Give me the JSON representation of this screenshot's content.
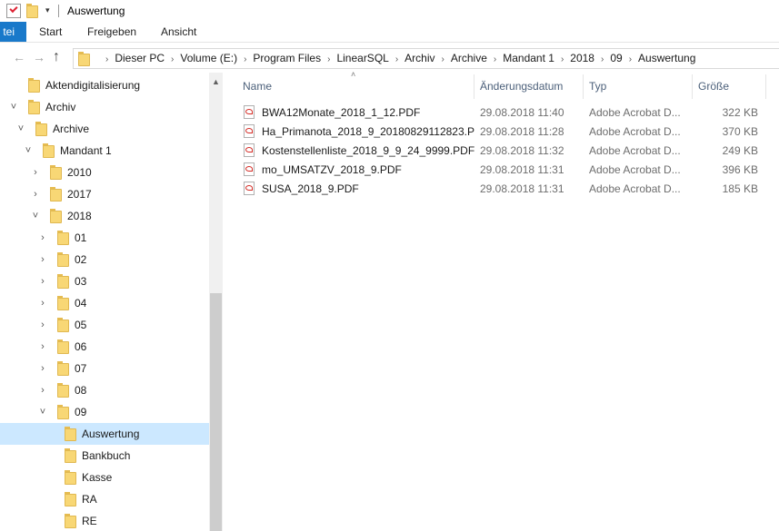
{
  "window": {
    "title": "Auswertung",
    "quick_access_dropdown": "▾"
  },
  "ribbon": {
    "tabs": [
      {
        "label": "tei"
      },
      {
        "label": "Start"
      },
      {
        "label": "Freigeben"
      },
      {
        "label": "Ansicht"
      }
    ]
  },
  "nav": {
    "back_icon": "←",
    "forward_icon": "→",
    "recent_icon": "˅",
    "up_icon": "↑"
  },
  "address": {
    "crumbs": [
      "Dieser PC",
      "Volume (E:)",
      "Program Files",
      "LinearSQL",
      "Archiv",
      "Archive",
      "Mandant 1",
      "2018",
      "09",
      "Auswertung"
    ],
    "separator": "›"
  },
  "tree": {
    "items": [
      {
        "label": "Aktendigitalisierung",
        "chevron": ""
      },
      {
        "label": "Archiv",
        "chevron": "˅"
      },
      {
        "label": "Archive",
        "chevron": "˅"
      },
      {
        "label": "Mandant 1",
        "chevron": "˅"
      },
      {
        "label": "2010",
        "chevron": "›"
      },
      {
        "label": "2017",
        "chevron": "›"
      },
      {
        "label": "2018",
        "chevron": "˅"
      },
      {
        "label": "01",
        "chevron": "›"
      },
      {
        "label": "02",
        "chevron": "›"
      },
      {
        "label": "03",
        "chevron": "›"
      },
      {
        "label": "04",
        "chevron": "›"
      },
      {
        "label": "05",
        "chevron": "›"
      },
      {
        "label": "06",
        "chevron": "›"
      },
      {
        "label": "07",
        "chevron": "›"
      },
      {
        "label": "08",
        "chevron": "›"
      },
      {
        "label": "09",
        "chevron": "˅"
      },
      {
        "label": "Auswertung",
        "chevron": "",
        "selected": true
      },
      {
        "label": "Bankbuch",
        "chevron": ""
      },
      {
        "label": "Kasse",
        "chevron": ""
      },
      {
        "label": "RA",
        "chevron": ""
      },
      {
        "label": "RE",
        "chevron": ""
      }
    ],
    "scroll_up_icon": "▲"
  },
  "files": {
    "sort_indicator": "˄",
    "columns": {
      "name": "Name",
      "date": "Änderungsdatum",
      "type": "Typ",
      "size": "Größe"
    },
    "rows": [
      {
        "name": "BWA12Monate_2018_1_12.PDF",
        "date": "29.08.2018 11:40",
        "type": "Adobe Acrobat D...",
        "size": "322 KB"
      },
      {
        "name": "Ha_Primanota_2018_9_20180829112823.P",
        "date": "29.08.2018 11:28",
        "type": "Adobe Acrobat D...",
        "size": "370 KB"
      },
      {
        "name": "Kostenstellenliste_2018_9_9_24_9999.PDF",
        "date": "29.08.2018 11:32",
        "type": "Adobe Acrobat D...",
        "size": "249 KB"
      },
      {
        "name": "mo_UMSATZV_2018_9.PDF",
        "date": "29.08.2018 11:31",
        "type": "Adobe Acrobat D...",
        "size": "396 KB"
      },
      {
        "name": "SUSA_2018_9.PDF",
        "date": "29.08.2018 11:31",
        "type": "Adobe Acrobat D...",
        "size": "185 KB"
      }
    ]
  },
  "icons": {
    "properties": "properties-icon",
    "folder": "folder-icon",
    "pdf": "pdf-file-icon"
  },
  "colors": {
    "selection": "#cce8ff",
    "file_tab": "#1979ca",
    "folder": "#f8d775"
  }
}
